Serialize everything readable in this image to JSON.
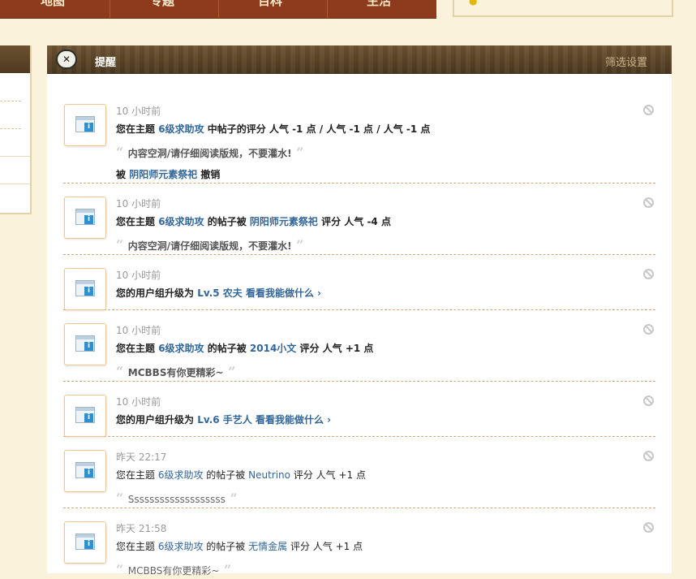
{
  "topnav": {
    "labels": [
      "地图",
      "专题",
      "百科",
      "生活"
    ]
  },
  "panel": {
    "header": {
      "logo_glyph": "✕",
      "title": "提醒",
      "filter_label": "筛选设置"
    }
  },
  "notices": [
    {
      "time": "10 小时前",
      "line": [
        {
          "t": "您在主题 "
        },
        {
          "t": "6级求助攻",
          "link": true
        },
        {
          "t": " 中帖子的评分 人气 -1 点 / 人气 -1 点 / 人气 -1 点"
        }
      ],
      "bold": true,
      "quote": "内容空洞/请仔细阅读版规，不要灌水!",
      "extra": [
        {
          "t": "被 "
        },
        {
          "t": "阴阳师元素祭祀",
          "link": true
        },
        {
          "t": " 撤销"
        }
      ]
    },
    {
      "time": "10 小时前",
      "line": [
        {
          "t": "您在主题 "
        },
        {
          "t": "6级求助攻",
          "link": true
        },
        {
          "t": " 的帖子被 "
        },
        {
          "t": "阴阳师元素祭祀",
          "link": true
        },
        {
          "t": " 评分 人气 -4 点"
        }
      ],
      "bold": true,
      "quote": "内容空洞/请仔细阅读版规，不要灌水!"
    },
    {
      "time": "10 小时前",
      "line": [
        {
          "t": "您的用户组升级为 "
        },
        {
          "t": "Lv.5 农夫",
          "link": true
        },
        {
          "t": "  "
        },
        {
          "t": "看看我能做什么 ›",
          "link": true
        }
      ],
      "bold": true
    },
    {
      "time": "10 小时前",
      "line": [
        {
          "t": "您在主题 "
        },
        {
          "t": "6级求助攻",
          "link": true
        },
        {
          "t": " 的帖子被 "
        },
        {
          "t": "2014小文",
          "link": true
        },
        {
          "t": " 评分 人气 +1 点"
        }
      ],
      "bold": true,
      "quote": "MCBBS有你更精彩~"
    },
    {
      "time": "10 小时前",
      "line": [
        {
          "t": "您的用户组升级为 "
        },
        {
          "t": "Lv.6 手艺人",
          "link": true
        },
        {
          "t": "  "
        },
        {
          "t": "看看我能做什么 ›",
          "link": true
        }
      ],
      "bold": true
    },
    {
      "time": "昨天 22:17",
      "line": [
        {
          "t": "您在主题 "
        },
        {
          "t": "6级求助攻",
          "link": true
        },
        {
          "t": " 的帖子被 "
        },
        {
          "t": "Neutrino",
          "link": true
        },
        {
          "t": " 评分 人气 +1 点"
        }
      ],
      "bold": false,
      "quote": "Sssssssssssssssssss"
    },
    {
      "time": "昨天 21:58",
      "line": [
        {
          "t": "您在主题 "
        },
        {
          "t": "6级求助攻",
          "link": true
        },
        {
          "t": " 的帖子被 "
        },
        {
          "t": "无情金属",
          "link": true
        },
        {
          "t": " 评分 人气 +1 点"
        }
      ],
      "bold": false,
      "quote": "MCBBS有你更精彩~"
    }
  ],
  "colors": {
    "link": "#336699",
    "header_bg": "#5b4428",
    "page_bg": "#fbf2db"
  }
}
